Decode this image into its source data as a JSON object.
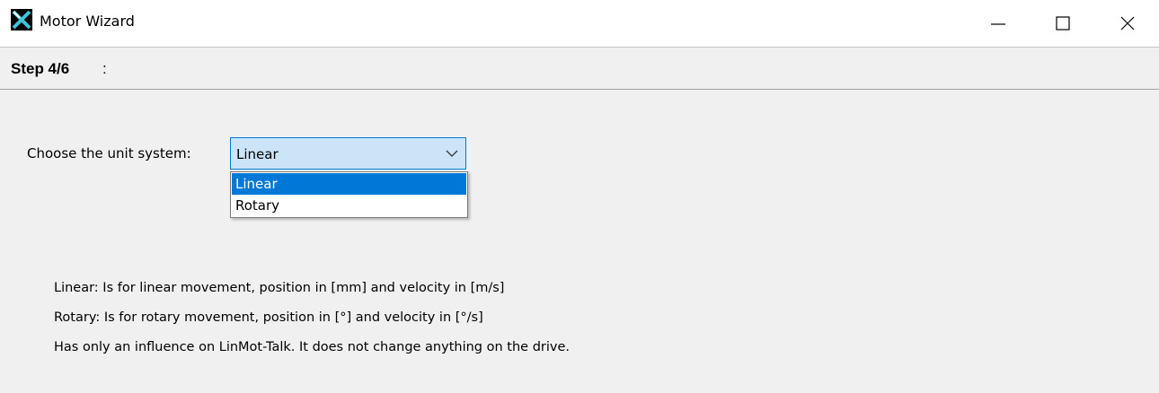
{
  "window": {
    "title": "Motor Wizard",
    "icon": "app-x-icon",
    "accent": "#0078d7"
  },
  "controls": {
    "minimize_icon": "minimize-icon",
    "maximize_icon": "maximize-icon",
    "close_icon": "close-icon"
  },
  "step": {
    "title": "Step 4/6",
    "suffix": ":"
  },
  "unit_select": {
    "label": "Choose the unit system:",
    "selected": "Linear",
    "options": [
      "Linear",
      "Rotary"
    ],
    "highlighted_option": "Linear"
  },
  "descriptions": [
    "Linear: Is for linear movement, position in [mm] and velocity in [m/s]",
    "Rotary: Is for rotary movement, position in [°] and velocity in [°/s]",
    "Has only an influence on LinMot-Talk. It does not change anything on the drive."
  ]
}
